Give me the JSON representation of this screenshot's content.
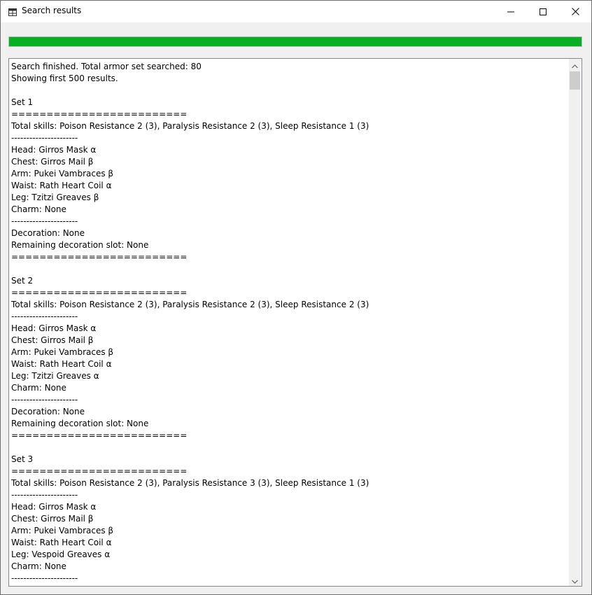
{
  "window": {
    "title": "Search results",
    "icon": "table-icon",
    "controls": [
      "minimize-icon",
      "maximize-icon",
      "close-icon"
    ]
  },
  "progress": {
    "value_percent": 100,
    "color": "#06b025"
  },
  "results": {
    "lines": [
      "Search finished. Total armor set searched: 80",
      "Showing first 500 results.",
      "",
      "Set 1",
      "=========================",
      "Total skills: Poison Resistance 2 (3), Paralysis Resistance 2 (3), Sleep Resistance 1 (3)",
      "----------------------",
      "Head: Girros Mask α",
      "Chest: Girros Mail β",
      "Arm: Pukei Vambraces β",
      "Waist: Rath Heart Coil α",
      "Leg: Tzitzi Greaves β",
      "Charm: None",
      "----------------------",
      "Decoration: None",
      "Remaining decoration slot: None",
      "=========================",
      "",
      "Set 2",
      "=========================",
      "Total skills: Poison Resistance 2 (3), Paralysis Resistance 2 (3), Sleep Resistance 2 (3)",
      "----------------------",
      "Head: Girros Mask α",
      "Chest: Girros Mail β",
      "Arm: Pukei Vambraces β",
      "Waist: Rath Heart Coil α",
      "Leg: Tzitzi Greaves α",
      "Charm: None",
      "----------------------",
      "Decoration: None",
      "Remaining decoration slot: None",
      "=========================",
      "",
      "Set 3",
      "=========================",
      "Total skills: Poison Resistance 2 (3), Paralysis Resistance 3 (3), Sleep Resistance 1 (3)",
      "----------------------",
      "Head: Girros Mask α",
      "Chest: Girros Mail β",
      "Arm: Pukei Vambraces β",
      "Waist: Rath Heart Coil α",
      "Leg: Vespoid Greaves α",
      "Charm: None",
      "----------------------"
    ]
  }
}
